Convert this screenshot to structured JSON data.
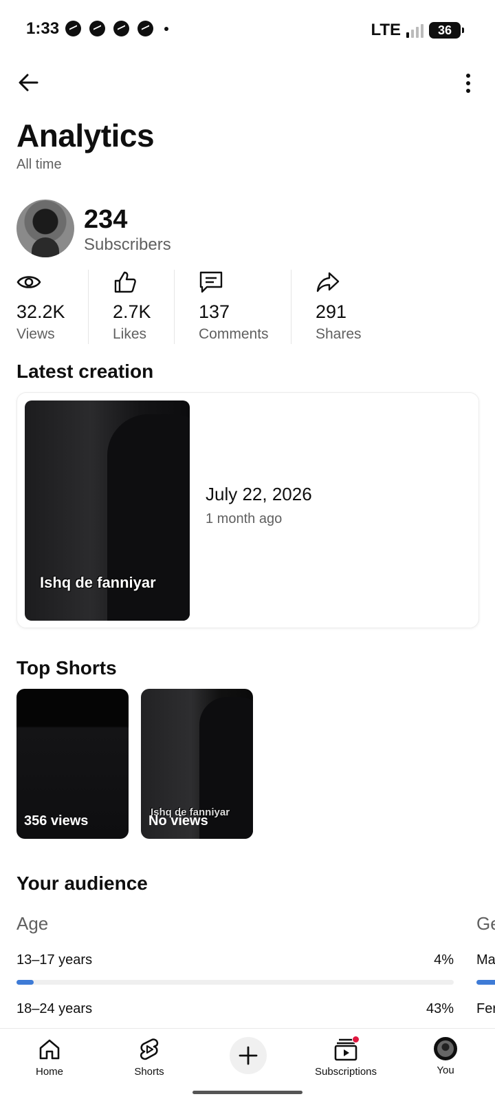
{
  "status_bar": {
    "time": "1:33",
    "network": "LTE",
    "battery": "36"
  },
  "header": {
    "title": "Analytics",
    "subtitle": "All time"
  },
  "channel": {
    "subscribers_count": "234",
    "subscribers_label": "Subscribers"
  },
  "stats": [
    {
      "icon": "eye-icon",
      "value": "32.2K",
      "label": "Views"
    },
    {
      "icon": "thumbs-up-icon",
      "value": "2.7K",
      "label": "Likes"
    },
    {
      "icon": "comment-icon",
      "value": "137",
      "label": "Comments"
    },
    {
      "icon": "share-icon",
      "value": "291",
      "label": "Shares"
    }
  ],
  "latest_creation": {
    "heading": "Latest creation",
    "thumbnail_caption": "Ishq de fanniyar",
    "date": "July 22, 2026",
    "ago": "1 month ago"
  },
  "top_shorts": {
    "heading": "Top Shorts",
    "items": [
      {
        "views": "356 views"
      },
      {
        "views": "No views",
        "caption": "Ishq de fanniyar"
      }
    ]
  },
  "audience": {
    "heading": "Your audience",
    "age_label": "Age",
    "age_rows": [
      {
        "label": "13–17 years",
        "percent": "4%",
        "fraction": 0.04
      },
      {
        "label": "18–24 years",
        "percent": "43%",
        "fraction": 0.43
      }
    ],
    "gender_label": "Ge",
    "gender_rows": [
      {
        "label": "Ma"
      },
      {
        "label": "Fer"
      }
    ]
  },
  "bottom_nav": {
    "home": "Home",
    "shorts": "Shorts",
    "subscriptions": "Subscriptions",
    "you": "You"
  },
  "colors": {
    "accent_bar": "#3e7bd6",
    "notification_dot": "#e0163e"
  }
}
